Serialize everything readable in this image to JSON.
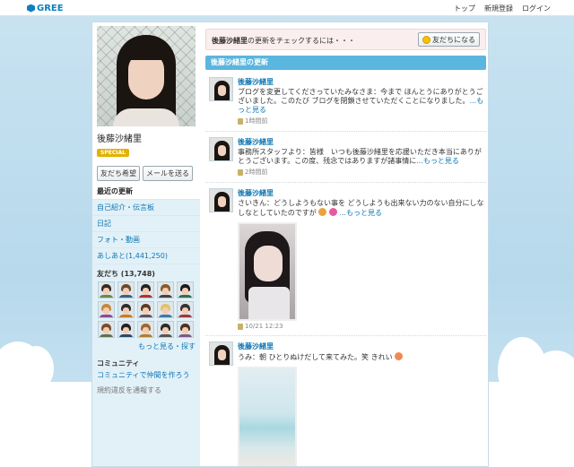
{
  "header": {
    "logo_text": "GREE",
    "nav": [
      "トップ",
      "新規登録",
      "ログイン"
    ]
  },
  "profile": {
    "name": "後藤沙緒里",
    "badge": "SPECIAL",
    "add_friend_label": "友だち希望",
    "send_mail_label": "メールを送る"
  },
  "sidebar": {
    "menu": [
      {
        "label": "最近の更新",
        "active": true
      },
      {
        "label": "自己紹介・伝言板",
        "active": false
      },
      {
        "label": "日記",
        "active": false
      },
      {
        "label": "フォト・動画",
        "active": false
      },
      {
        "label": "あしあと(1,441,250)",
        "active": false
      }
    ],
    "friends_title": "友だち (13,748)",
    "friends_more": "もっと見る・探す",
    "community_title": "コミュニティ",
    "community_link": "コミュニティで仲間を作ろう",
    "report_link": "規約違反を通報する"
  },
  "notice": {
    "name": "後藤沙緒里",
    "text": "の更新をチェックするには・・・",
    "button_label": "友だちになる"
  },
  "feed": {
    "header": "後藤沙緒里の更新",
    "items": [
      {
        "author": "後藤沙緒里",
        "text": "ブログを変更してくださっていたみなさま：今まで ほんとうにありがとうございました。このたび ブログを閉鎖させていただくことになりました。",
        "more": "...もっと見る",
        "time": "1時間前"
      },
      {
        "author": "後藤沙緒里",
        "text": "事務所スタッフより：皆様　いつも後藤沙緒里を応援いただき本当にありがとうございます。この度、残念ではありますが諸事情に",
        "more": "...もっと見る",
        "time": "2時間前"
      },
      {
        "author": "後藤沙緒里",
        "text": "さいきん：どうしようもない事を どうしようも出来ない力のない自分にしなしなとしていたのですが",
        "more": "...もっと見る",
        "time": "10/21 12:23"
      },
      {
        "author": "後藤沙緒里",
        "text": "うみ：朝 ひとりぬけだして来てみた。笑 きれい"
      }
    ]
  },
  "colors": {
    "accent": "#5ab6de",
    "link": "#0f76b3",
    "special_badge": "#e3b100",
    "notice_bg": "#fbeeee"
  },
  "icons": [
    "gree-logo-icon",
    "smile-icon",
    "memo-icon"
  ]
}
